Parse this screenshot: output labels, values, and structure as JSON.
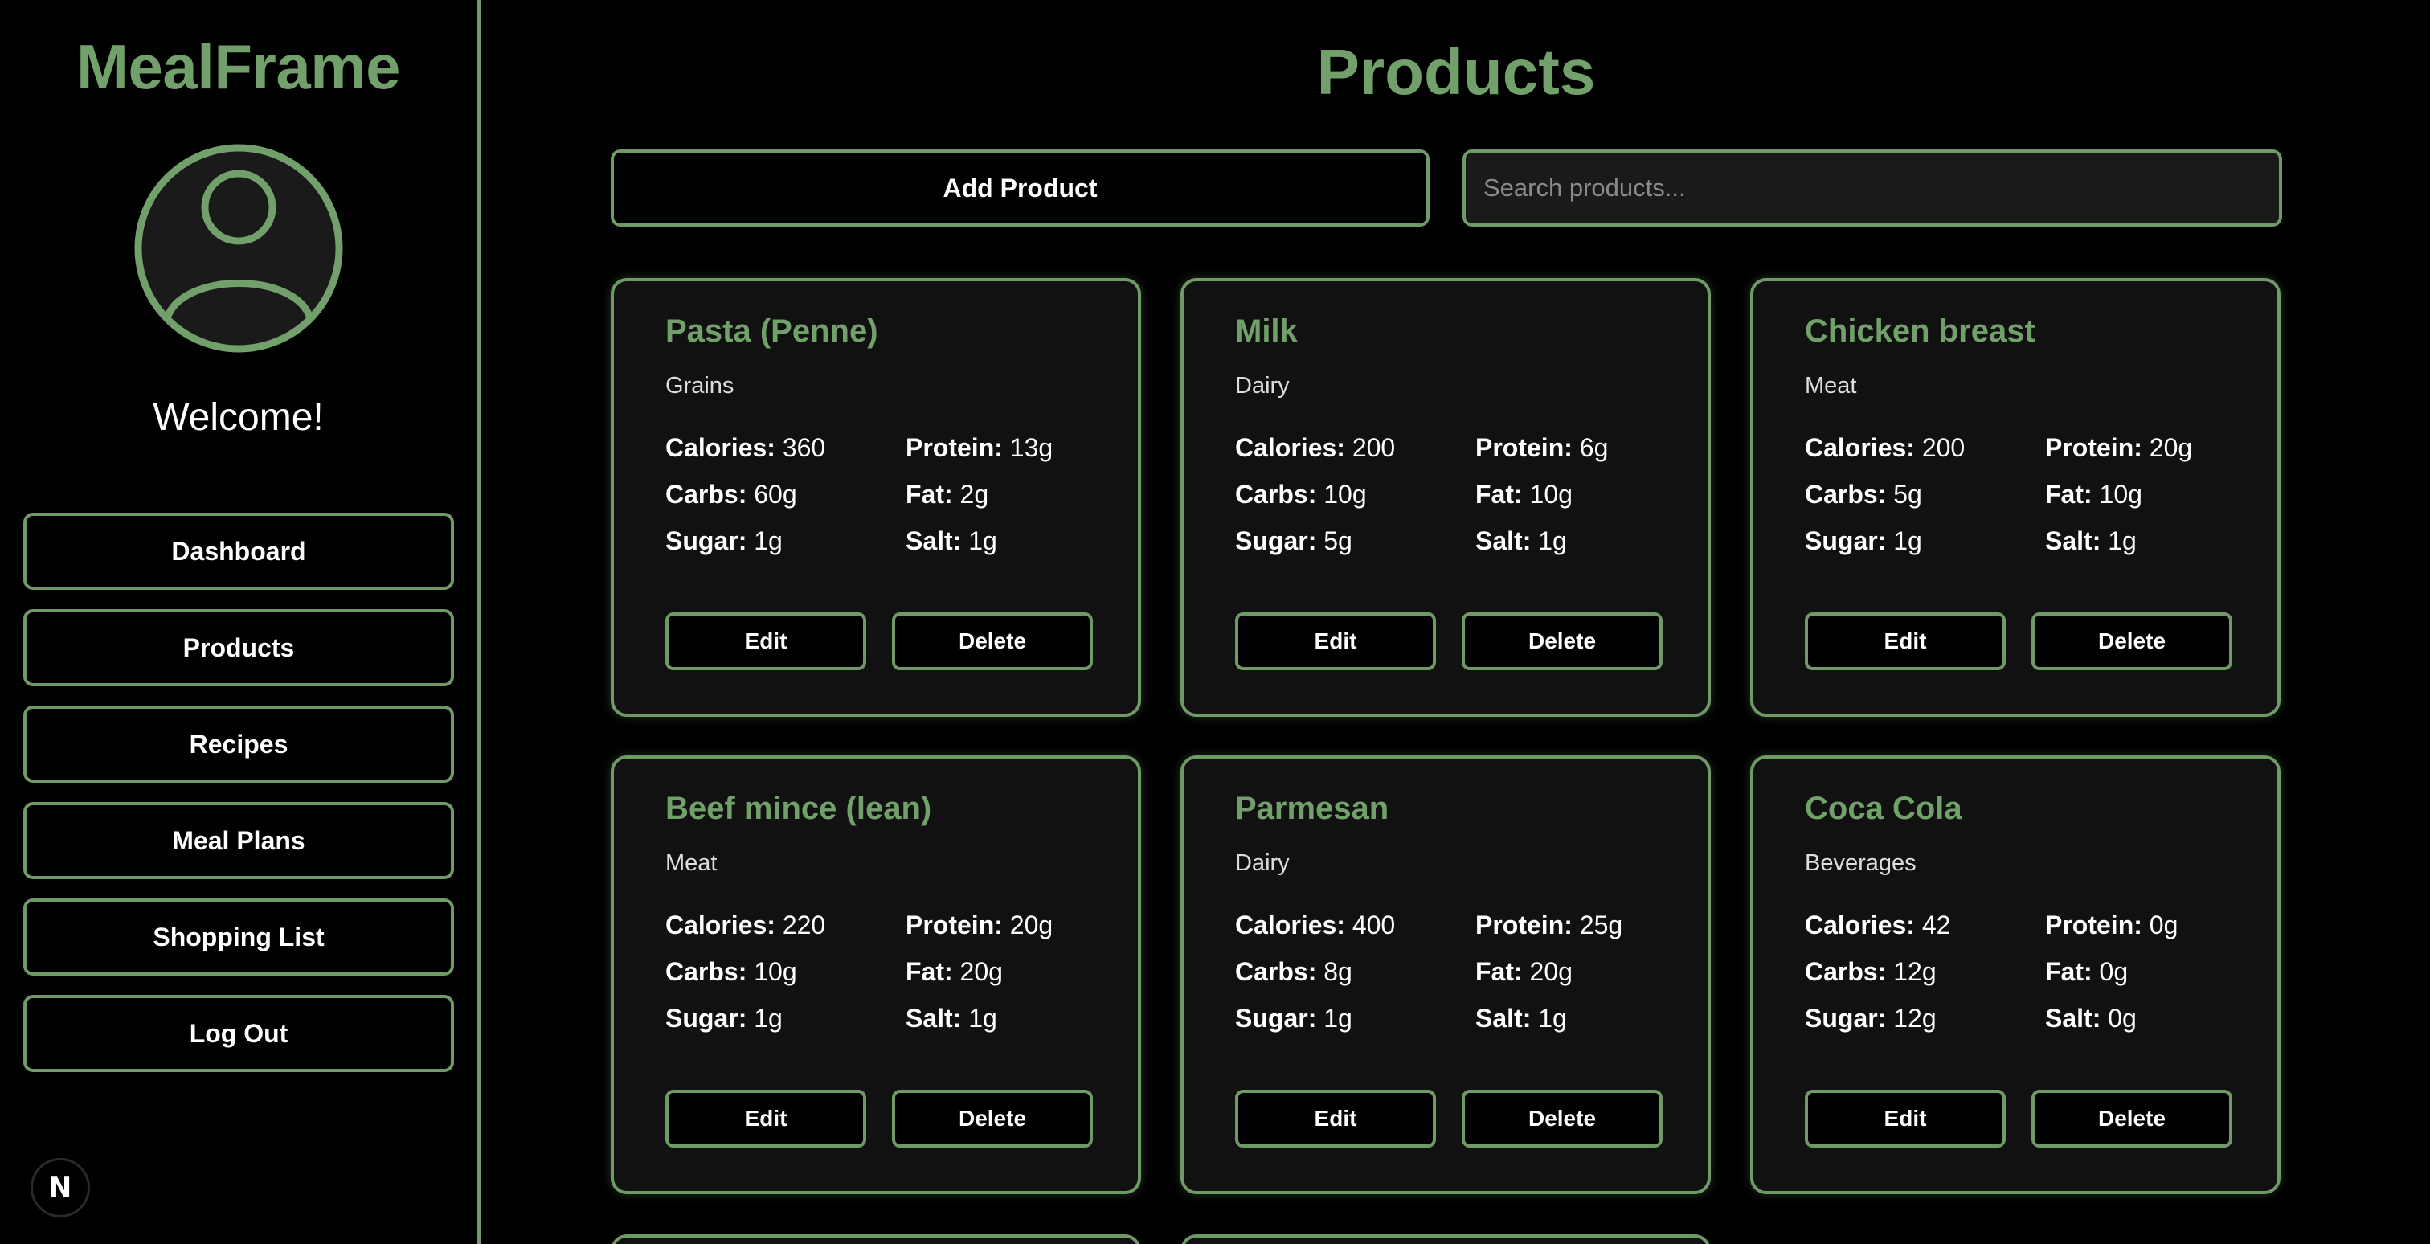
{
  "app": {
    "brand": "MealFrame",
    "welcome": "Welcome!"
  },
  "nav": [
    {
      "label": "Dashboard"
    },
    {
      "label": "Products"
    },
    {
      "label": "Recipes"
    },
    {
      "label": "Meal Plans"
    },
    {
      "label": "Shopping List"
    },
    {
      "label": "Log Out"
    }
  ],
  "badge": {
    "letter": "N"
  },
  "page": {
    "title": "Products",
    "add_label": "Add Product",
    "search_placeholder": "Search products..."
  },
  "labels": {
    "calories": "Calories:",
    "protein": "Protein:",
    "carbs": "Carbs:",
    "fat": "Fat:",
    "sugar": "Sugar:",
    "salt": "Salt:",
    "edit": "Edit",
    "delete": "Delete"
  },
  "products": [
    {
      "name": "Pasta (Penne)",
      "category": "Grains",
      "calories": "360",
      "protein": "13g",
      "carbs": "60g",
      "fat": "2g",
      "sugar": "1g",
      "salt": "1g"
    },
    {
      "name": "Milk",
      "category": "Dairy",
      "calories": "200",
      "protein": "6g",
      "carbs": "10g",
      "fat": "10g",
      "sugar": "5g",
      "salt": "1g"
    },
    {
      "name": "Chicken breast",
      "category": "Meat",
      "calories": "200",
      "protein": "20g",
      "carbs": "5g",
      "fat": "10g",
      "sugar": "1g",
      "salt": "1g"
    },
    {
      "name": "Beef mince (lean)",
      "category": "Meat",
      "calories": "220",
      "protein": "20g",
      "carbs": "10g",
      "fat": "20g",
      "sugar": "1g",
      "salt": "1g"
    },
    {
      "name": "Parmesan",
      "category": "Dairy",
      "calories": "400",
      "protein": "25g",
      "carbs": "8g",
      "fat": "20g",
      "sugar": "1g",
      "salt": "1g"
    },
    {
      "name": "Coca Cola",
      "category": "Beverages",
      "calories": "42",
      "protein": "0g",
      "carbs": "12g",
      "fat": "0g",
      "sugar": "12g",
      "salt": "0g"
    }
  ],
  "colors": {
    "accent": "#72a06a",
    "border": "#6f9a66",
    "card_bg": "#111111",
    "background": "#000000"
  }
}
